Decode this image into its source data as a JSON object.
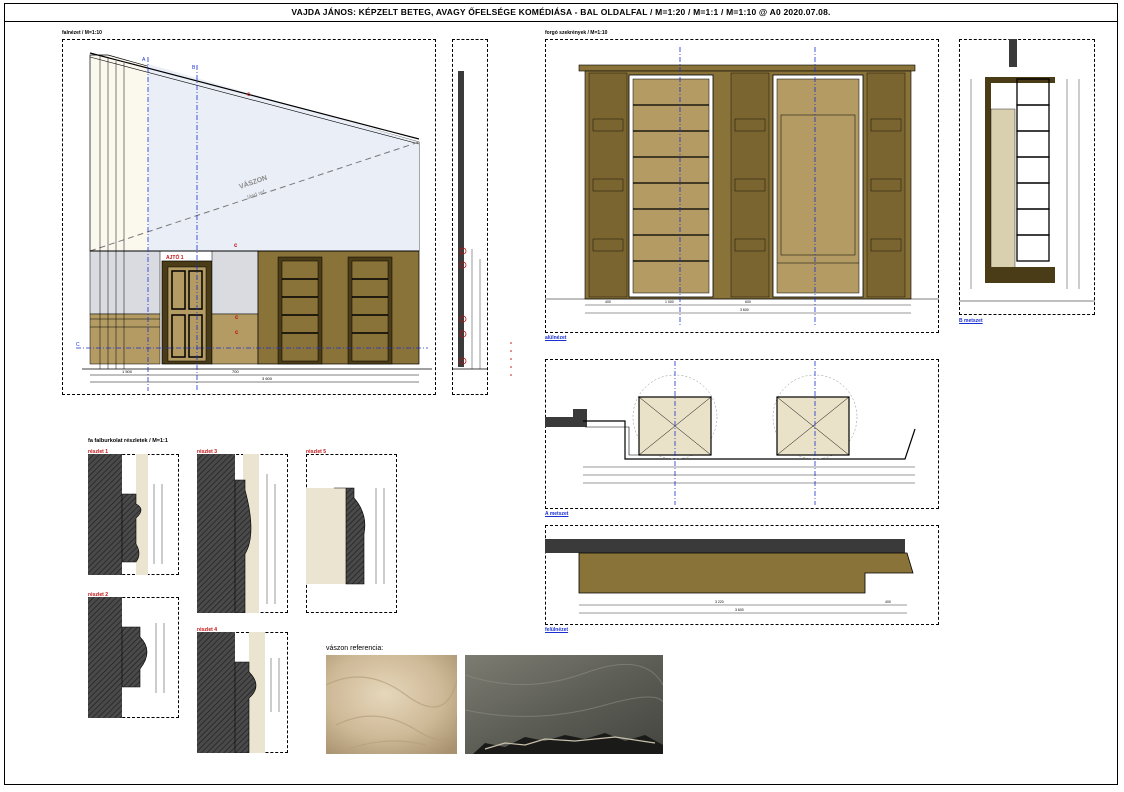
{
  "title": "VAJDA JÁNOS: KÉPZELT BETEG, AVAGY ŐFELSÉGE KOMÉDIÁSA    -    BAL OLDALFAL / M=1:20 / M=1:1 / M=1:10 @ A0      2020.07.08.",
  "views": {
    "falnezet": "falnézet / M=1:10",
    "forgo": "forgó szekrények / M=1:10",
    "alulnezet": "alülnézet",
    "b_metszet": "B metszet",
    "a_metszet": "A metszet",
    "felulnezet": "felülnézet",
    "faburkolat": "fa falburkolat részletek / M=1:1"
  },
  "details": [
    "részlet 1",
    "részlet 2",
    "részlet 3",
    "részlet 4",
    "részlet 5"
  ],
  "canvas_label": "VÁSZON",
  "canvas_sub": "lásd ref.",
  "door_label": "AJTÓ 1",
  "reference_caption": "vászon referencia:",
  "markers": {
    "a": "A",
    "b": "B",
    "c": "C"
  },
  "dims": {
    "wall_total": "3 600",
    "wall_part1": "1 500",
    "wall_part2": "700",
    "cab_total": "3 600",
    "cab_a": "400",
    "cab_b": "1 000",
    "cab_c": "600",
    "top_total": "3 600",
    "top_a": "3 220",
    "top_b": "400"
  },
  "colors": {
    "wood": "#8a7338",
    "wood_light": "#b39b63",
    "wood_dark": "#4a3c17",
    "plaster": "#d9dbe0",
    "sky": "#fbf8ee",
    "hatch": "#3a3a3a",
    "blue_axis": "#1a2fd0",
    "red_mark": "#c01010"
  }
}
